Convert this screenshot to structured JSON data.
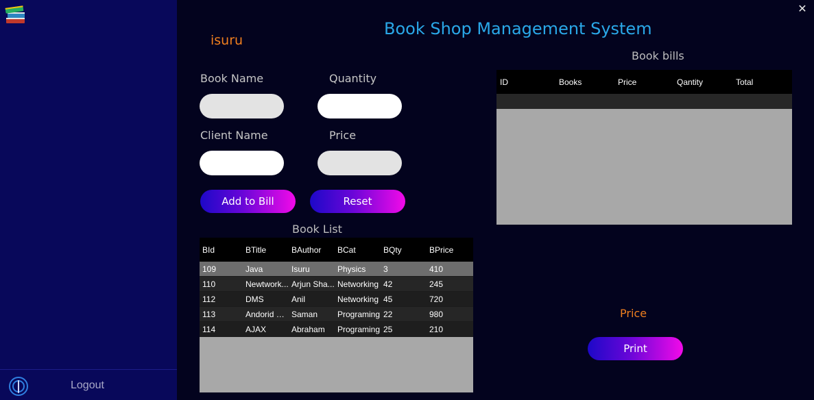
{
  "app": {
    "title": "Book Shop Management System",
    "close_glyph": "✕"
  },
  "user": {
    "name": "isuru"
  },
  "sidebar": {
    "logo_icon": "books-stack-icon",
    "logout_icon": "power-icon",
    "logout_label": "Logout"
  },
  "form": {
    "book_name_label": "Book Name",
    "quantity_label": "Quantity",
    "client_name_label": "Client Name",
    "price_label": "Price",
    "book_name_value": "",
    "quantity_value": "",
    "client_name_value": "",
    "price_value": "",
    "add_button": "Add to Bill",
    "reset_button": "Reset"
  },
  "book_list": {
    "title": "Book List",
    "columns": [
      "BId",
      "BTitle",
      "BAuthor",
      "BCat",
      "BQty",
      "BPrice"
    ],
    "rows": [
      [
        "109",
        "Java",
        "Isuru",
        "Physics",
        "3",
        "410"
      ],
      [
        "110",
        "Newtwork...",
        "Arjun Sha...",
        "Networking",
        "42",
        "245"
      ],
      [
        "112",
        "DMS",
        "Anil",
        "Networking",
        "45",
        "720"
      ],
      [
        "113",
        "Andorid D...",
        "Saman",
        "Programing",
        "22",
        "980"
      ],
      [
        "114",
        "AJAX",
        "Abraham",
        "Programing",
        "25",
        "210"
      ]
    ],
    "selected_row": 0
  },
  "bills": {
    "title": "Book bills",
    "columns": [
      "ID",
      "Books",
      "Price",
      "Qantity",
      "Total"
    ]
  },
  "total": {
    "label": "Price"
  },
  "print_button": "Print",
  "colors": {
    "sidebar_bg": "#08085a",
    "main_bg": "#03031e",
    "title": "#2aa8e8",
    "accent_orange": "#f07f1e",
    "button_gradient_start": "#1d08c8",
    "button_gradient_end": "#f20ae8",
    "grid_bg": "#a8a8a8",
    "selected_row": "#6e6e6e"
  }
}
